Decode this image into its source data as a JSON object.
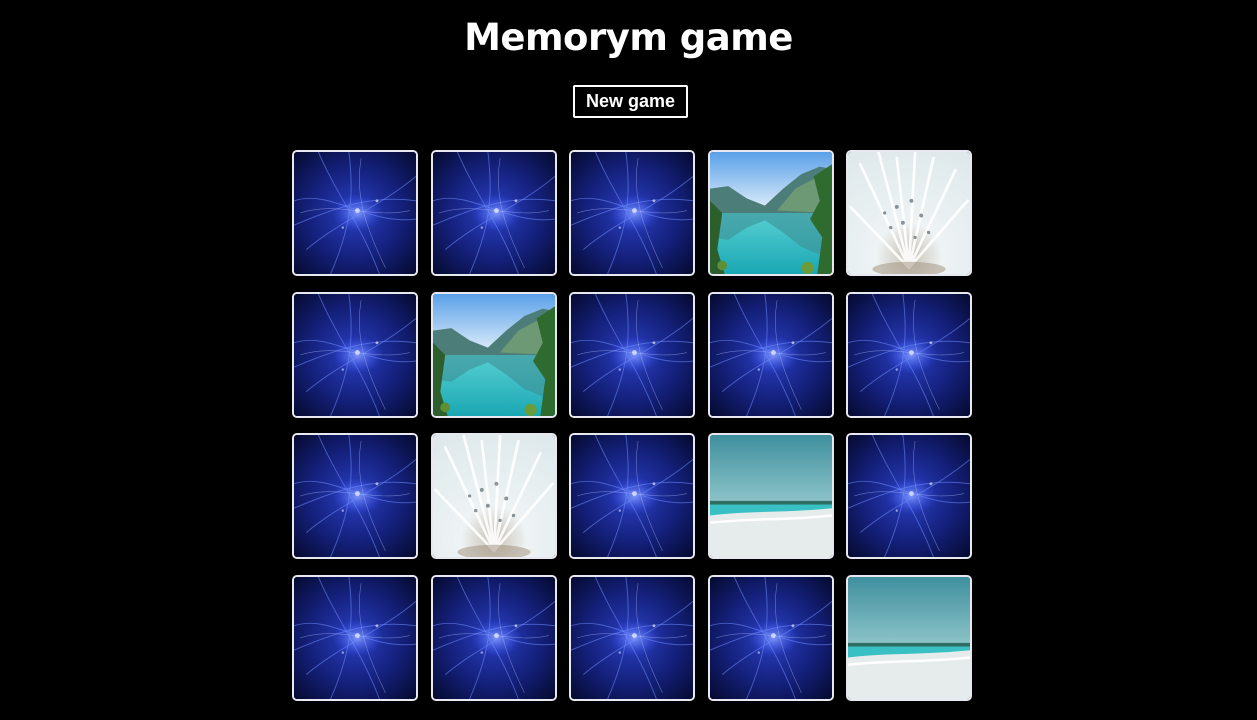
{
  "header": {
    "title": "Memorym game",
    "new_game_label": "New game"
  },
  "board": {
    "columns": 5,
    "rows": 4,
    "cards": [
      {
        "state": "face-down",
        "image": "blue-light-card-back"
      },
      {
        "state": "face-down",
        "image": "blue-light-card-back"
      },
      {
        "state": "face-down",
        "image": "blue-light-card-back"
      },
      {
        "state": "face-up",
        "image": "mountain-lake"
      },
      {
        "state": "face-up",
        "image": "white-dandelion"
      },
      {
        "state": "face-down",
        "image": "blue-light-card-back"
      },
      {
        "state": "face-up",
        "image": "mountain-lake"
      },
      {
        "state": "face-down",
        "image": "blue-light-card-back"
      },
      {
        "state": "face-down",
        "image": "blue-light-card-back"
      },
      {
        "state": "face-down",
        "image": "blue-light-card-back"
      },
      {
        "state": "face-down",
        "image": "blue-light-card-back"
      },
      {
        "state": "face-up",
        "image": "white-dandelion"
      },
      {
        "state": "face-down",
        "image": "blue-light-card-back"
      },
      {
        "state": "face-up",
        "image": "tropical-beach"
      },
      {
        "state": "face-down",
        "image": "blue-light-card-back"
      },
      {
        "state": "face-down",
        "image": "blue-light-card-back"
      },
      {
        "state": "face-down",
        "image": "blue-light-card-back"
      },
      {
        "state": "face-down",
        "image": "blue-light-card-back"
      },
      {
        "state": "face-down",
        "image": "blue-light-card-back"
      },
      {
        "state": "face-up",
        "image": "tropical-beach"
      }
    ]
  },
  "colors": {
    "background": "#000000",
    "text": "#ffffff",
    "card_border": "#e8e8f0",
    "card_back_dark": "#07113f",
    "card_back_light": "#3f64ff"
  }
}
